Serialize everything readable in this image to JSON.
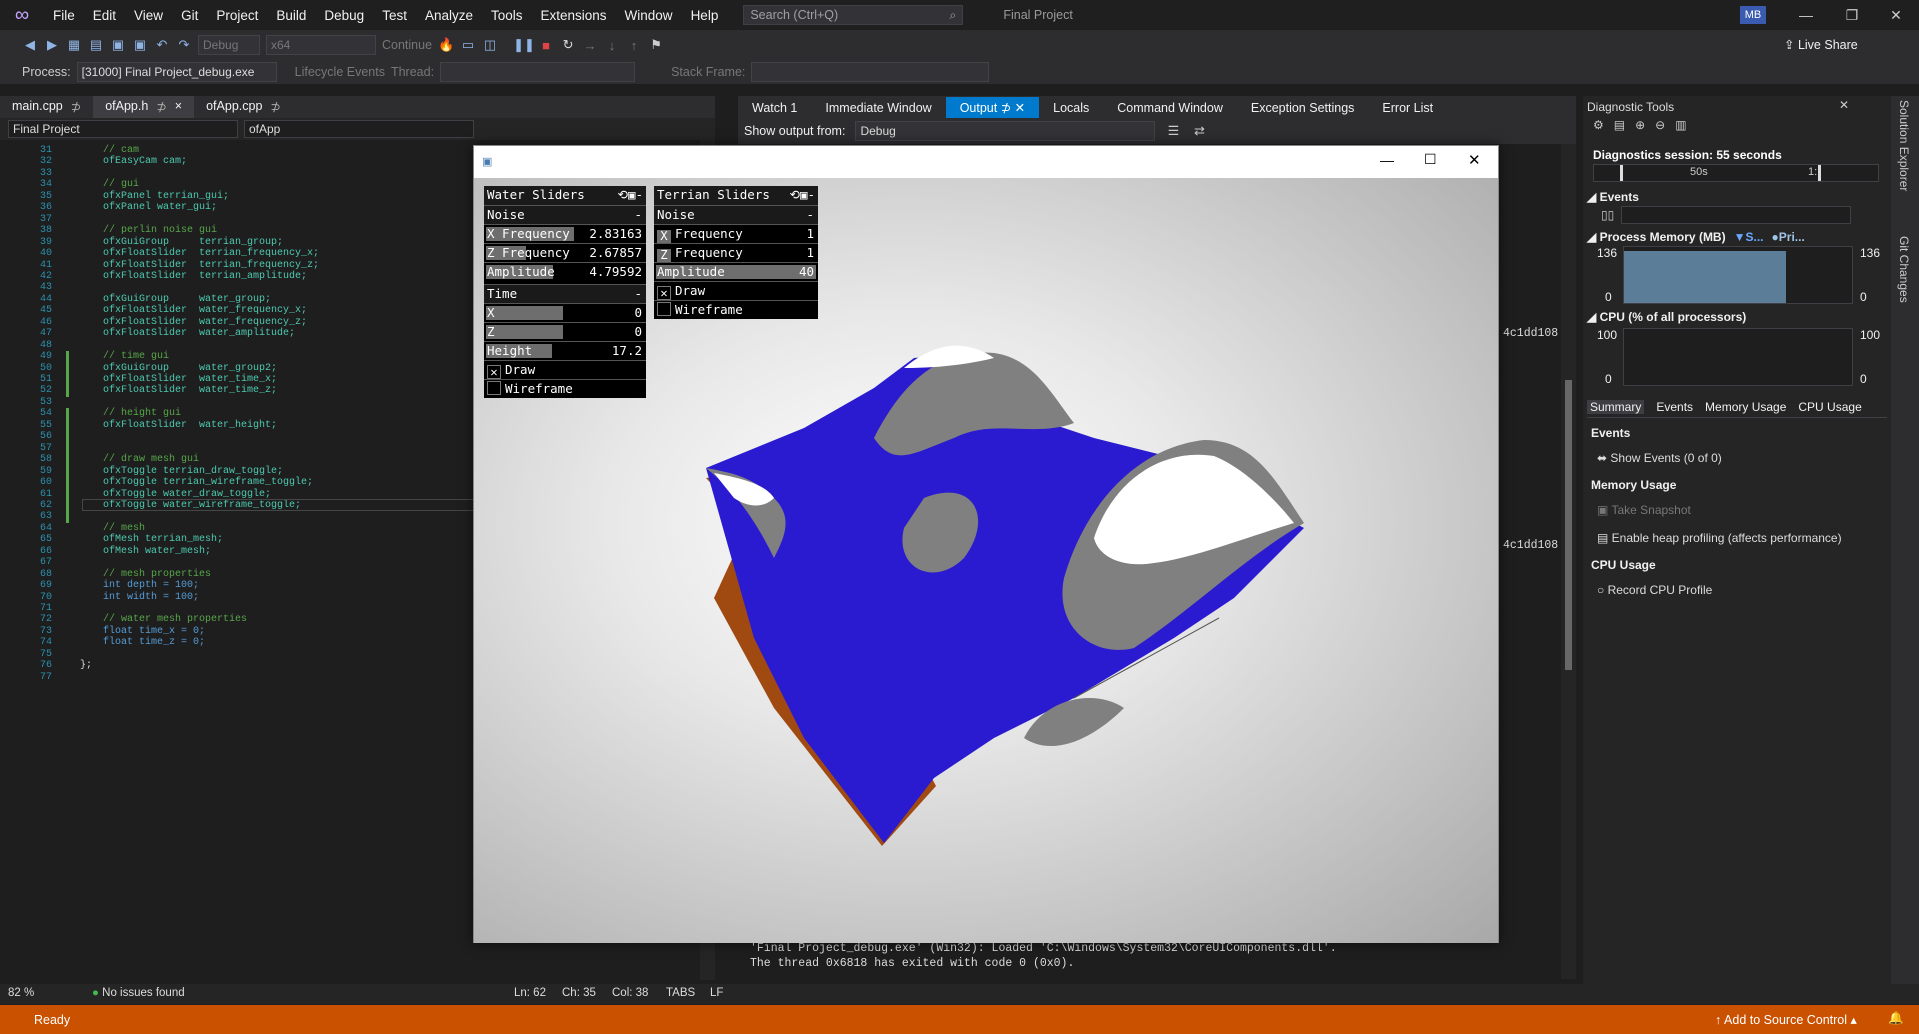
{
  "titlebar": {
    "menus": [
      "File",
      "Edit",
      "View",
      "Git",
      "Project",
      "Build",
      "Debug",
      "Test",
      "Analyze",
      "Tools",
      "Extensions",
      "Window",
      "Help"
    ],
    "search_placeholder": "Search (Ctrl+Q)",
    "project_name": "Final Project",
    "avatar": "MB"
  },
  "toolbar": {
    "config": "Debug",
    "platform": "x64",
    "continue": "Continue",
    "live_share": "Live Share",
    "process_label": "Process:",
    "process_value": "[31000] Final Project_debug.exe",
    "lifecycle": "Lifecycle Events",
    "thread": "Thread:",
    "stack_frame": "Stack Frame:"
  },
  "editor": {
    "tabs": [
      {
        "label": "main.cpp",
        "pin": "⊅"
      },
      {
        "label": "ofApp.h",
        "pin": "⊅",
        "close": "×"
      },
      {
        "label": "ofApp.cpp",
        "pin": "⊅"
      }
    ],
    "nav_project": "Final Project",
    "nav_class": "ofApp"
  },
  "code_lines": [
    {
      "n": "31",
      "t": "// cam",
      "k": "cm"
    },
    {
      "n": "32",
      "t": "ofEasyCam cam;",
      "k": "ty"
    },
    {
      "n": "33",
      "t": ""
    },
    {
      "n": "34",
      "t": "// gui",
      "k": "cm"
    },
    {
      "n": "35",
      "t": "ofxPanel terrian_gui;",
      "k": "ty"
    },
    {
      "n": "36",
      "t": "ofxPanel water_gui;",
      "k": "ty"
    },
    {
      "n": "37",
      "t": ""
    },
    {
      "n": "38",
      "t": "// perlin noise gui",
      "k": "cm"
    },
    {
      "n": "39",
      "t": "ofxGuiGroup     terrian_group;",
      "k": "ty"
    },
    {
      "n": "40",
      "t": "ofxFloatSlider  terrian_frequency_x;",
      "k": "ty"
    },
    {
      "n": "41",
      "t": "ofxFloatSlider  terrian_frequency_z;",
      "k": "ty"
    },
    {
      "n": "42",
      "t": "ofxFloatSlider  terrian_amplitude;",
      "k": "ty"
    },
    {
      "n": "43",
      "t": ""
    },
    {
      "n": "44",
      "t": "ofxGuiGroup     water_group;",
      "k": "ty"
    },
    {
      "n": "45",
      "t": "ofxFloatSlider  water_frequency_x;",
      "k": "ty"
    },
    {
      "n": "46",
      "t": "ofxFloatSlider  water_frequency_z;",
      "k": "ty"
    },
    {
      "n": "47",
      "t": "ofxFloatSlider  water_amplitude;",
      "k": "ty"
    },
    {
      "n": "48",
      "t": ""
    },
    {
      "n": "49",
      "t": "// time gui",
      "k": "cm"
    },
    {
      "n": "50",
      "t": "ofxGuiGroup     water_group2;",
      "k": "ty"
    },
    {
      "n": "51",
      "t": "ofxFloatSlider  water_time_x;",
      "k": "ty"
    },
    {
      "n": "52",
      "t": "ofxFloatSlider  water_time_z;",
      "k": "ty"
    },
    {
      "n": "53",
      "t": ""
    },
    {
      "n": "54",
      "t": "// height gui",
      "k": "cm"
    },
    {
      "n": "55",
      "t": "ofxFloatSlider  water_height;",
      "k": "ty"
    },
    {
      "n": "56",
      "t": ""
    },
    {
      "n": "57",
      "t": ""
    },
    {
      "n": "58",
      "t": "// draw mesh gui",
      "k": "cm"
    },
    {
      "n": "59",
      "t": "ofxToggle terrian_draw_toggle;",
      "k": "ty"
    },
    {
      "n": "60",
      "t": "ofxToggle terrian_wireframe_toggle;",
      "k": "ty"
    },
    {
      "n": "61",
      "t": "ofxToggle water_draw_toggle;",
      "k": "ty"
    },
    {
      "n": "62",
      "t": "ofxToggle water_wireframe_toggle;",
      "k": "ty"
    },
    {
      "n": "63",
      "t": ""
    },
    {
      "n": "64",
      "t": "// mesh",
      "k": "cm"
    },
    {
      "n": "65",
      "t": "ofMesh terrian_mesh;",
      "k": "ty"
    },
    {
      "n": "66",
      "t": "ofMesh water_mesh;",
      "k": "ty"
    },
    {
      "n": "67",
      "t": ""
    },
    {
      "n": "68",
      "t": "// mesh properties",
      "k": "cm"
    },
    {
      "n": "69",
      "t": "int depth = 100;",
      "k": "kw"
    },
    {
      "n": "70",
      "t": "int width = 100;",
      "k": "kw"
    },
    {
      "n": "71",
      "t": ""
    },
    {
      "n": "72",
      "t": "// water mesh properties",
      "k": "cm"
    },
    {
      "n": "73",
      "t": "float time_x = 0;",
      "k": "kw"
    },
    {
      "n": "74",
      "t": "float time_z = 0;",
      "k": "kw"
    },
    {
      "n": "75",
      "t": ""
    },
    {
      "n": "76",
      "t": "};"
    },
    {
      "n": "77",
      "t": ""
    }
  ],
  "editor_status": {
    "zoom": "82 %",
    "issues": "No issues found",
    "ln": "Ln: 62",
    "ch": "Ch: 35",
    "col": "Col: 38",
    "tabs": "TABS",
    "eol": "LF"
  },
  "output": {
    "tabs": [
      "Watch 1",
      "Immediate Window",
      "Output",
      "Locals",
      "Command Window",
      "Exception Settings",
      "Error List"
    ],
    "show_from_label": "Show output from:",
    "show_from_value": "Debug",
    "frag1": "4c1dd108",
    "frag2": "4c1dd108",
    "lines": [
      "'Final Project_debug.exe' (Win32): Loaded 'C:\\Windows\\System32\\CoreUIComponents.dll'.",
      "The thread 0x6818 has exited with code 0 (0x0)."
    ]
  },
  "diagnostics": {
    "title": "Diagnostic Tools",
    "session": "Diagnostics session: 55 seconds",
    "tick_50": "50s",
    "tick_1": "1:",
    "events_label": "Events",
    "memory_label": "Process Memory (MB)",
    "memory_legend1": "S...",
    "memory_legend2": "Pri...",
    "memory_max": "136",
    "memory_min": "0",
    "memory_value_fraction": 0.93,
    "cpu_label": "CPU (% of all processors)",
    "cpu_max": "100",
    "cpu_min": "0",
    "tabs": [
      "Summary",
      "Events",
      "Memory Usage",
      "CPU Usage"
    ],
    "sec_events": "Events",
    "show_events": "Show Events (0 of 0)",
    "sec_memory": "Memory Usage",
    "take_snapshot": "Take Snapshot",
    "heap_profiling": "Enable heap profiling (affects performance)",
    "sec_cpu": "CPU Usage",
    "record_cpu": "Record CPU Profile"
  },
  "side_tabs": [
    "Solution Explorer",
    "Git Changes"
  ],
  "status": {
    "ready": "Ready",
    "source_control": "Add to Source Control"
  },
  "water_panel": {
    "title": "Water Sliders",
    "group1": "Noise",
    "xf_label": "X Frequency",
    "xf_value": "2.83163",
    "xf_fill": 0.57,
    "zf_label": "Z Frequency",
    "zf_value": "2.67857",
    "zf_fill": 0.27,
    "amp_label": "Amplitude",
    "amp_value": "4.79592",
    "amp_fill": 0.44,
    "group2": "Time",
    "tx_label": "X",
    "tx_value": "0",
    "tx_fill": 0.5,
    "tz_label": "Z",
    "tz_value": "0",
    "tz_fill": 0.5,
    "height_label": "Height",
    "height_value": "17.2",
    "height_fill": 0.43,
    "draw_label": "Draw",
    "draw_checked": true,
    "wire_label": "Wireframe",
    "wire_checked": false
  },
  "terrain_panel": {
    "title": "Terrian Sliders",
    "group1": "Noise",
    "xf_label": "Frequency",
    "xf_prefix": "X",
    "xf_value": "1",
    "zf_label": "Frequency",
    "zf_prefix": "Z",
    "zf_value": "1",
    "amp_label": "Amplitude",
    "amp_value": "40",
    "amp_fill": 1.0,
    "draw_label": "Draw",
    "draw_checked": true,
    "wire_label": "Wireframe",
    "wire_checked": false
  },
  "colors": {
    "accent": "#007acc",
    "status": "#ca5100",
    "water": "#2a1bd0",
    "terrain": "#7a7a7a",
    "snow": "#ffffff",
    "dirt": "#a04a12"
  }
}
